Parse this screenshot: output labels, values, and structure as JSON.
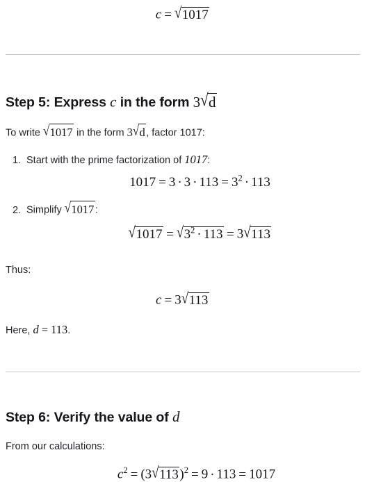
{
  "document": {
    "top_equation": {
      "lhs_var": "c",
      "equals": "=",
      "radical_sign": "√",
      "radicand": "1017",
      "plain": "c = √1017"
    },
    "sections": [
      {
        "heading_prefix": "Step 5: Express ",
        "heading_var": "c",
        "heading_middle": " in the form ",
        "heading_coefficient": "3",
        "heading_radical_sign": "√",
        "heading_radicand": "d",
        "heading_plain": "Step 5: Express c in the form 3√d",
        "intro_prefix": "To write ",
        "intro_radical_sign": "√",
        "intro_radicand": "1017",
        "intro_middle": " in the form ",
        "intro_coefficient": "3",
        "intro_radicand2": "d",
        "intro_suffix": ", factor 1017:",
        "intro_plain": "To write √1017 in the form 3√d, factor 1017:",
        "list": [
          {
            "marker": "1.",
            "text_prefix": "Start with the prime factorization of ",
            "text_number": "1017",
            "text_suffix": ":",
            "plain": "Start with the prime factorization of 1017:"
          },
          {
            "marker": "2.",
            "text_prefix": "Simplify ",
            "radical_sign": "√",
            "radicand": "1017",
            "text_suffix": ":",
            "plain": "Simplify √1017:"
          }
        ],
        "factorization_equation": {
          "lhs": "1017",
          "equals": "=",
          "term1": "3",
          "dot": "·",
          "term2": "3",
          "term3": "113",
          "equals2": "=",
          "base": "3",
          "exponent": "2",
          "final_term": "113",
          "plain": "1017 = 3 · 3 · 113 = 3² · 113"
        },
        "simplify_equation": {
          "radical_sign": "√",
          "lhs_radicand": "1017",
          "equals": "=",
          "mid_base": "3",
          "mid_exponent": "2",
          "mid_dot": "·",
          "mid_term": "113",
          "equals2": "=",
          "coefficient": "3",
          "final_radicand": "113",
          "plain": "√1017 = √(3² · 113) = 3√113"
        },
        "thus_label": "Thus:",
        "result_equation": {
          "lhs_var": "c",
          "equals": "=",
          "coefficient": "3",
          "radical_sign": "√",
          "radicand": "113",
          "plain": "c = 3√113"
        },
        "conclusion_prefix": "Here, ",
        "conclusion_var": "d",
        "conclusion_equals": "=",
        "conclusion_value": "113",
        "conclusion_suffix": ".",
        "conclusion_plain": "Here, d = 113."
      },
      {
        "heading_prefix": "Step 6: Verify the value of ",
        "heading_var": "d",
        "heading_plain": "Step 6: Verify the value of d",
        "intro_plain": "From our calculations:",
        "verify_equation": {
          "lhs_var": "c",
          "lhs_exponent": "2",
          "equals": "=",
          "open_paren": "(",
          "coefficient": "3",
          "radical_sign": "√",
          "radicand": "113",
          "close_paren": ")",
          "outer_exponent": "2",
          "equals2": "=",
          "term1": "9",
          "dot": "·",
          "term2": "113",
          "equals3": "=",
          "result": "1017",
          "plain": "c² = (3√113)² = 9 · 113 = 1017"
        }
      }
    ],
    "colors": {
      "text": "#22252a",
      "heading": "#14161a",
      "math": "#14161a",
      "rule": "#c9c9c9",
      "background": "#ffffff"
    }
  }
}
